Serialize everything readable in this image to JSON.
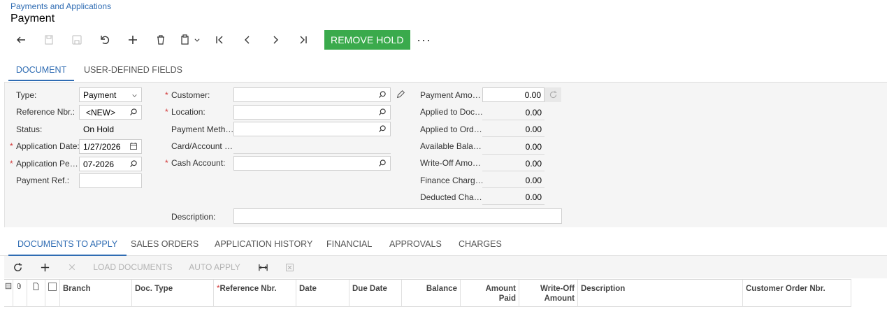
{
  "breadcrumb": "Payments and Applications",
  "title": "Payment",
  "toolbar": {
    "remove_hold": "REMOVE HOLD",
    "more": "···"
  },
  "main_tabs": [
    "DOCUMENT",
    "USER-DEFINED FIELDS"
  ],
  "form": {
    "type_label": "Type:",
    "type_value": "Payment",
    "ref_label": "Reference Nbr.:",
    "ref_value": "<NEW>",
    "status_label": "Status:",
    "status_value": "On Hold",
    "app_date_label": "Application Date:",
    "app_date_value": "1/27/2026",
    "app_period_label": "Application Pe…",
    "app_period_value": "07-2026",
    "payment_ref_label": "Payment Ref.:",
    "payment_ref_value": "",
    "customer_label": "Customer:",
    "location_label": "Location:",
    "payment_method_label": "Payment Meth…",
    "card_account_label": "Card/Account …",
    "cash_account_label": "Cash Account:",
    "description_label": "Description:",
    "description_value": "",
    "payment_amount_label": "Payment Amo…",
    "payment_amount_value": "0.00",
    "applied_docs_label": "Applied to Doc…",
    "applied_docs_value": "0.00",
    "applied_orders_label": "Applied to Ord…",
    "applied_orders_value": "0.00",
    "available_label": "Available Bala…",
    "available_value": "0.00",
    "writeoff_label": "Write-Off Amo…",
    "writeoff_value": "0.00",
    "finance_label": "Finance Charg…",
    "finance_value": "0.00",
    "deducted_label": "Deducted Cha…",
    "deducted_value": "0.00"
  },
  "sub_tabs": [
    "DOCUMENTS TO APPLY",
    "SALES ORDERS",
    "APPLICATION HISTORY",
    "FINANCIAL",
    "APPROVALS",
    "CHARGES"
  ],
  "grid_toolbar": {
    "load_documents": "LOAD DOCUMENTS",
    "auto_apply": "AUTO APPLY"
  },
  "grid_columns": {
    "branch": "Branch",
    "doc_type": "Doc. Type",
    "reference_nbr": "Reference Nbr.",
    "date": "Date",
    "due_date": "Due Date",
    "balance": "Balance",
    "amount_paid_1": "Amount",
    "amount_paid_2": "Paid",
    "writeoff_1": "Write-Off",
    "writeoff_2": "Amount",
    "description": "Description",
    "customer_order_nbr": "Customer Order Nbr."
  },
  "colors": {
    "accent": "#2f6cb3",
    "hold_button": "#3aaa4c",
    "required": "#d23a3a"
  }
}
